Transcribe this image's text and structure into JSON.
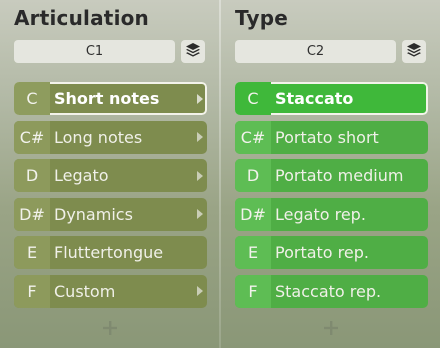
{
  "articulation": {
    "title": "Articulation",
    "key": "C1",
    "rows": [
      {
        "note": "C",
        "label": "Short notes",
        "has_submenu": true
      },
      {
        "note": "C#",
        "label": "Long notes",
        "has_submenu": true
      },
      {
        "note": "D",
        "label": "Legato",
        "has_submenu": true
      },
      {
        "note": "D#",
        "label": "Dynamics",
        "has_submenu": true
      },
      {
        "note": "E",
        "label": "Fluttertongue",
        "has_submenu": false
      },
      {
        "note": "F",
        "label": "Custom",
        "has_submenu": true
      }
    ]
  },
  "type": {
    "title": "Type",
    "key": "C2",
    "rows": [
      {
        "note": "C",
        "label": "Staccato"
      },
      {
        "note": "C#",
        "label": "Portato short"
      },
      {
        "note": "D",
        "label": "Portato medium"
      },
      {
        "note": "D#",
        "label": "Legato rep."
      },
      {
        "note": "E",
        "label": "Portato rep."
      },
      {
        "note": "F",
        "label": "Staccato rep."
      }
    ]
  },
  "icons": {
    "layers": "layers-icon",
    "chevron": "chevron-right-icon",
    "add": "plus-icon"
  },
  "colors": {
    "articulation_row": "#7e8c4e",
    "type_row": "#4fae45",
    "selected_border": "#f3f3ea"
  }
}
